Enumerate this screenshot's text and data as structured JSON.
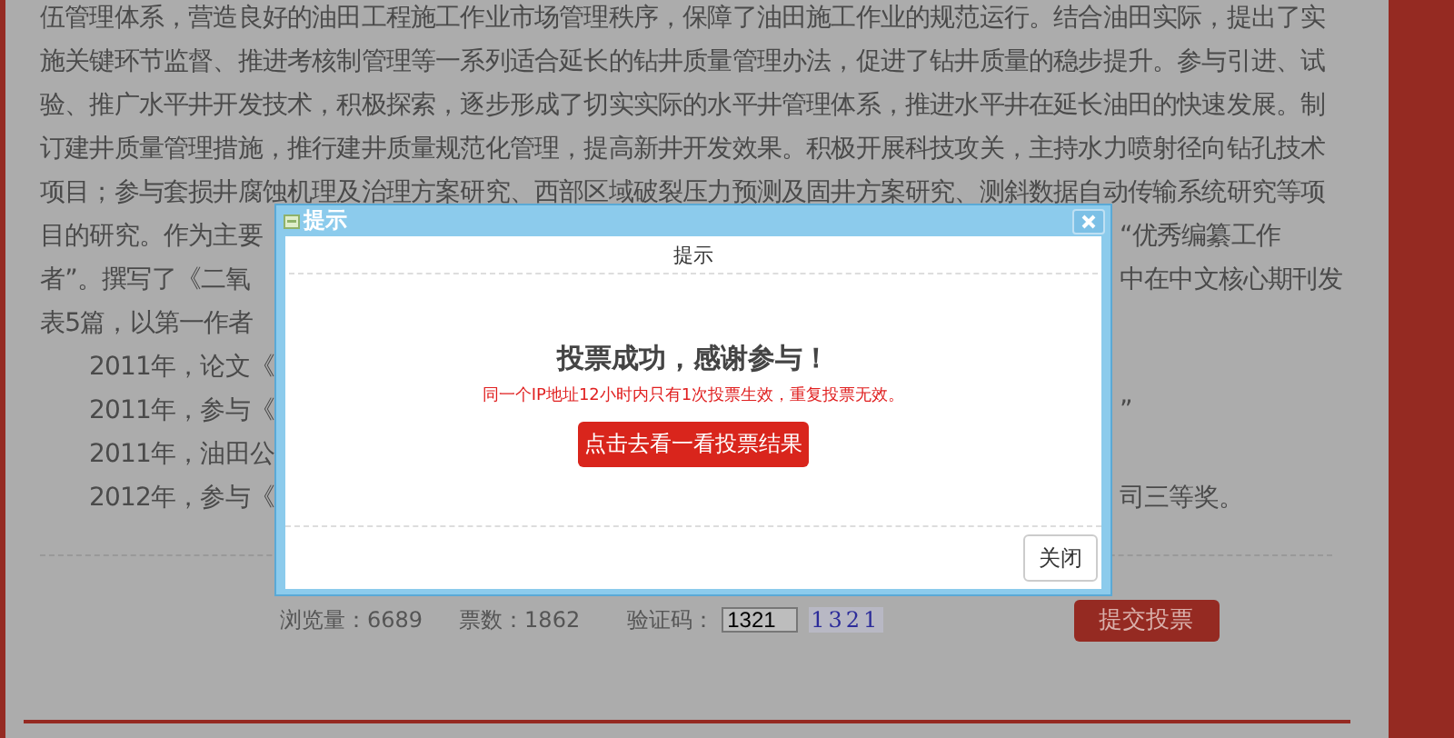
{
  "article": {
    "lines": [
      "伍管理体系，营造良好的油田工程施工作业市场管理秩序，保障了油田施工作业的规范运行。结合油田实际，提出了实",
      "施关键环节监督、推进考核制管理等一系列适合延长的钻井质量管理办法，促进了钻井质量的稳步提升。参与引进、试",
      "验、推广水平井开发技术，积极探索，逐步形成了切实实际的水平井管理体系，推进水平井在延长油田的快速发展。制",
      "订建井质量管理措施，推行建井质量规范化管理，提高新井开发效果。积极开展科技攻关，主持水力喷射径向钻孔技术",
      "项目；参与套损井腐蚀机理及治理方案研究、西部区域破裂压力预测及固井方案研究、测斜数据自动传输系统研究等项"
    ],
    "partial_lines": [
      {
        "kind": "plain",
        "left": "目的研究。作为主要",
        "right": "“优秀编纂工作"
      },
      {
        "kind": "plain",
        "left": "者”。撰写了《二氧",
        "right": "中在中文核心期刊发"
      },
      {
        "kind": "plain",
        "left": "表5篇，以第一作者"
      },
      {
        "kind": "indented",
        "left": "2011年，论文《"
      },
      {
        "kind": "indented",
        "left": "2011年，参与《",
        "right": "”"
      },
      {
        "kind": "indented",
        "left": "2011年，油田公"
      },
      {
        "kind": "indented",
        "left": "2012年，参与《",
        "right": "司三等奖。"
      }
    ]
  },
  "stats": [
    "浏览量：6689",
    "票数：1862"
  ],
  "captcha": {
    "label": "验证码：",
    "value": "1321",
    "code": "1321"
  },
  "submit_button": "提交投票",
  "dialog": {
    "title": "提示",
    "header": "提示",
    "heading": "投票成功，感谢参与！",
    "notice": "同一个IP地址12小时内只有1次投票生效，重复投票无效。",
    "result_button": "点击去看一看投票结果",
    "close_button": "关闭"
  }
}
